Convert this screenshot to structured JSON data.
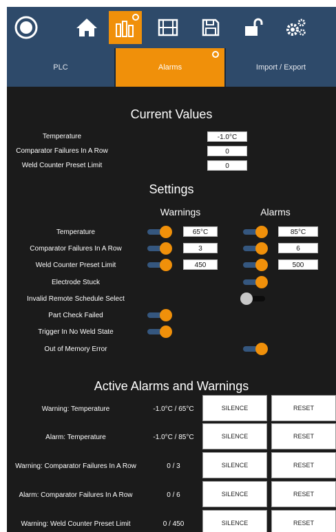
{
  "topbar": {
    "icons": [
      "circle-logo-icon",
      "home-icon",
      "bar-chart-icon",
      "film-icon",
      "save-icon",
      "lock-icon",
      "gears-icon"
    ],
    "active_index": 2
  },
  "tabs": [
    {
      "label": "PLC",
      "active": false
    },
    {
      "label": "Alarms",
      "active": true
    },
    {
      "label": "Import / Export",
      "active": false
    }
  ],
  "current_values": {
    "title": "Current Values",
    "rows": [
      {
        "label": "Temperature",
        "value": "-1.0°C"
      },
      {
        "label": "Comparator Failures In A Row",
        "value": "0"
      },
      {
        "label": "Weld Counter Preset Limit",
        "value": "0"
      }
    ]
  },
  "settings": {
    "title": "Settings",
    "warnings_header": "Warnings",
    "alarms_header": "Alarms",
    "rows": [
      {
        "label": "Temperature",
        "warning_enabled": true,
        "warning_value": "65°C",
        "alarm_enabled": true,
        "alarm_value": "85°C"
      },
      {
        "label": "Comparator Failures In A Row",
        "warning_enabled": true,
        "warning_value": "3",
        "alarm_enabled": true,
        "alarm_value": "6"
      },
      {
        "label": "Weld Counter Preset Limit",
        "warning_enabled": true,
        "warning_value": "450",
        "alarm_enabled": true,
        "alarm_value": "500"
      },
      {
        "label": "Electrode Stuck",
        "warning_enabled": null,
        "alarm_enabled": true
      },
      {
        "label": "Invalid Remote Schedule Select",
        "warning_enabled": null,
        "alarm_enabled": false
      },
      {
        "label": "Part Check Failed",
        "warning_enabled": true,
        "alarm_enabled": null
      },
      {
        "label": "Trigger In No Weld State",
        "warning_enabled": true,
        "alarm_enabled": null
      },
      {
        "label": "Out of Memory Error",
        "warning_enabled": null,
        "alarm_enabled": true
      }
    ]
  },
  "active": {
    "title": "Active Alarms and Warnings",
    "silence_label": "SILENCE",
    "reset_label": "RESET",
    "rows": [
      {
        "label": "Warning: Temperature",
        "value": "-1.0°C / 65°C"
      },
      {
        "label": "Alarm: Temperature",
        "value": "-1.0°C / 85°C"
      },
      {
        "label": "Warning: Comparator Failures In A Row",
        "value": "0 / 3"
      },
      {
        "label": "Alarm: Comparator Failures In A Row",
        "value": "0 / 6"
      },
      {
        "label": "Warning: Weld Counter Preset Limit",
        "value": "0 / 450"
      }
    ]
  },
  "colors": {
    "accent": "#f0900a",
    "nav": "#2e4a6a",
    "background": "#1b1b1b"
  }
}
